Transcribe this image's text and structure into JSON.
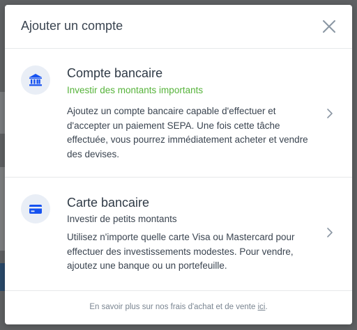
{
  "modal": {
    "title": "Ajouter un compte"
  },
  "options": [
    {
      "title": "Compte bancaire",
      "subtitle": "Investir des montants importants",
      "description": "Ajoutez un compte bancaire capable d'effectuer et d'accepter un paiement SEPA. Une fois cette tâche effectuée, vous pourrez immédiatement acheter et vendre des devises.",
      "icon": "bank-icon"
    },
    {
      "title": "Carte bancaire",
      "subtitle": "Investir de petits montants",
      "description": "Utilisez n'importe quelle carte Visa ou Mastercard pour effectuer des investissements modestes. Pour vendre, ajoutez une banque ou un portefeuille.",
      "icon": "credit-card-icon"
    }
  ],
  "footer": {
    "text": "En savoir plus sur nos frais d'achat et de vente ",
    "link": "ici",
    "suffix": "."
  },
  "colors": {
    "accent": "#1652f0",
    "highlight": "#56b33a"
  }
}
